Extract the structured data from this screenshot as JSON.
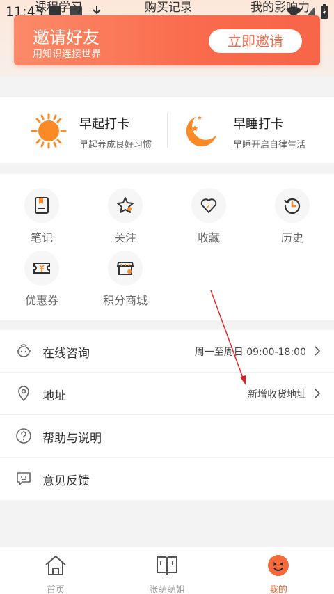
{
  "status_bar": {
    "time": "11:43"
  },
  "header_peek": {
    "left": "课程学习",
    "center": "购买记录",
    "right": "我的影响力"
  },
  "invite": {
    "title": "邀请好友",
    "subtitle": "用知识连接世界",
    "button": "立即邀请"
  },
  "punch": {
    "early": {
      "title": "早起打卡",
      "subtitle": "早起养成良好习惯",
      "icon": "sun-icon"
    },
    "sleep": {
      "title": "早睡打卡",
      "subtitle": "早睡开启自律生活",
      "icon": "moon-icon"
    }
  },
  "grid": {
    "items": [
      {
        "label": "笔记",
        "icon": "notebook-icon"
      },
      {
        "label": "关注",
        "icon": "star-icon"
      },
      {
        "label": "收藏",
        "icon": "favorite-heart-icon"
      },
      {
        "label": "历史",
        "icon": "history-icon"
      },
      {
        "label": "优惠券",
        "icon": "coupon-icon"
      },
      {
        "label": "积分商城",
        "icon": "shop-icon"
      }
    ]
  },
  "list": {
    "rows": [
      {
        "label": "在线咨询",
        "right": "周一至周日 09:00-18:00",
        "icon": "customer-service-icon"
      },
      {
        "label": "地址",
        "right": "新增收货地址",
        "icon": "location-icon"
      },
      {
        "label": "帮助与说明",
        "right": "",
        "icon": "help-icon"
      },
      {
        "label": "意见反馈",
        "right": "",
        "icon": "feedback-icon"
      }
    ]
  },
  "tabbar": {
    "tabs": [
      {
        "label": "首页",
        "icon": "home-icon"
      },
      {
        "label": "张萌萌姐",
        "icon": "book-icon"
      },
      {
        "label": "我的",
        "icon": "smiley-icon"
      }
    ],
    "active": "我的"
  },
  "colors": {
    "accent": "#f56a3a",
    "banner": "#f96b4c",
    "annotation": "#e02020"
  }
}
